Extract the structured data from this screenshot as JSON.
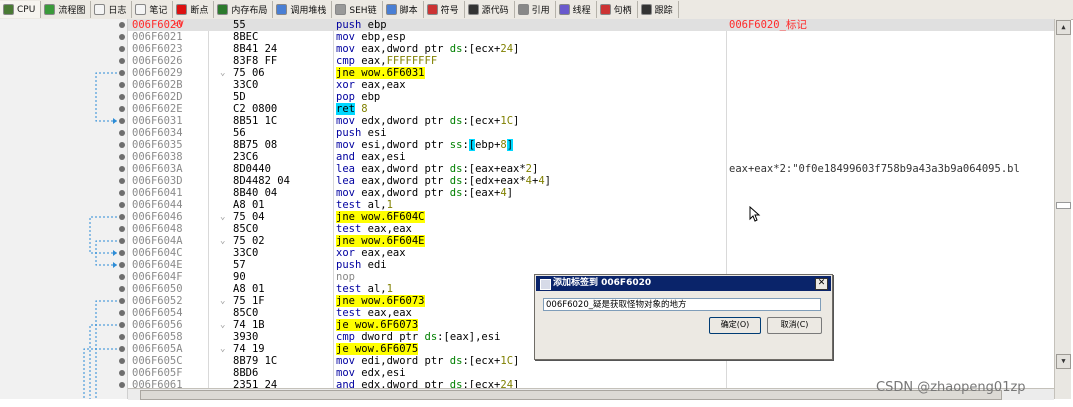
{
  "toolbar": {
    "tabs": [
      {
        "label": "CPU",
        "icon": "cpu-icon",
        "color": "#4a7a33"
      },
      {
        "label": "流程图",
        "icon": "flowchart-icon",
        "color": "#3a9a3a"
      },
      {
        "label": "日志",
        "icon": "log-icon",
        "color": "#f4f4f4"
      },
      {
        "label": "笔记",
        "icon": "notes-icon",
        "color": "#f4f4f4"
      },
      {
        "label": "断点",
        "icon": "breakpoint-icon",
        "color": "#d11"
      },
      {
        "label": "内存布局",
        "icon": "memory-map-icon",
        "color": "#2c7a2c"
      },
      {
        "label": "调用堆栈",
        "icon": "call-stack-icon",
        "color": "#4a7fd4"
      },
      {
        "label": "SEH链",
        "icon": "seh-chain-icon",
        "color": "#999"
      },
      {
        "label": "脚本",
        "icon": "script-icon",
        "color": "#4a7fd4"
      },
      {
        "label": "符号",
        "icon": "symbols-icon",
        "color": "#c33"
      },
      {
        "label": "源代码",
        "icon": "source-code-icon",
        "color": "#333"
      },
      {
        "label": "引用",
        "icon": "references-icon",
        "color": "#888"
      },
      {
        "label": "线程",
        "icon": "threads-icon",
        "color": "#6a5acd"
      },
      {
        "label": "句柄",
        "icon": "handles-icon",
        "color": "#c33"
      },
      {
        "label": "跟踪",
        "icon": "trace-icon",
        "color": "#333"
      }
    ]
  },
  "rows": [
    {
      "addr": "006F6020",
      "selmark": "<V",
      "jmark": "",
      "bytes": "55",
      "disasm": [
        [
          "kw",
          "push"
        ],
        [
          "t",
          " ebp"
        ]
      ],
      "comment": "006F6020_标记",
      "selected": true
    },
    {
      "addr": "006F6021",
      "bytes": "8BEC",
      "disasm": [
        [
          "kw",
          "mov"
        ],
        [
          "t",
          " ebp,esp"
        ]
      ]
    },
    {
      "addr": "006F6023",
      "bytes": "8B41 24",
      "disasm": [
        [
          "kw",
          "mov"
        ],
        [
          "t",
          " eax,dword ptr "
        ],
        [
          "sreg",
          "ds"
        ],
        [
          "t",
          ":[ecx+"
        ],
        [
          "num",
          "24"
        ],
        [
          "t",
          "]"
        ]
      ]
    },
    {
      "addr": "006F6026",
      "bytes": "83F8 FF",
      "disasm": [
        [
          "kw",
          "cmp"
        ],
        [
          "t",
          " eax,"
        ],
        [
          "num",
          "FFFFFFFF"
        ]
      ]
    },
    {
      "addr": "006F6029",
      "jmark": "⌄",
      "bytes": "75 06",
      "disasm": [
        [
          "hl",
          "jne wow.6F6031"
        ]
      ]
    },
    {
      "addr": "006F602B",
      "bytes": "33C0",
      "disasm": [
        [
          "kw",
          "xor"
        ],
        [
          "t",
          " eax,eax"
        ]
      ]
    },
    {
      "addr": "006F602D",
      "bytes": "5D",
      "disasm": [
        [
          "kw",
          "pop"
        ],
        [
          "t",
          " ebp"
        ]
      ]
    },
    {
      "addr": "006F602E",
      "bytes": "C2 0800",
      "disasm": [
        [
          "hlret",
          "ret"
        ],
        [
          "t",
          " "
        ],
        [
          "num",
          "8"
        ]
      ]
    },
    {
      "addr": "006F6031",
      "bytes": "8B51 1C",
      "disasm": [
        [
          "kw",
          "mov"
        ],
        [
          "t",
          " edx,dword ptr "
        ],
        [
          "sreg",
          "ds"
        ],
        [
          "t",
          ":[ecx+"
        ],
        [
          "num",
          "1C"
        ],
        [
          "t",
          "]"
        ]
      ]
    },
    {
      "addr": "006F6034",
      "bytes": "56",
      "disasm": [
        [
          "kw",
          "push"
        ],
        [
          "t",
          " esi"
        ]
      ]
    },
    {
      "addr": "006F6035",
      "bytes": "8B75 08",
      "disasm": [
        [
          "kw",
          "mov"
        ],
        [
          "t",
          " esi,dword ptr "
        ],
        [
          "sreg",
          "ss"
        ],
        [
          "t",
          ":"
        ],
        [
          "hlret",
          "["
        ],
        [
          "t",
          "ebp+"
        ],
        [
          "num",
          "8"
        ],
        [
          "hlret",
          "]"
        ]
      ]
    },
    {
      "addr": "006F6038",
      "bytes": "23C6",
      "disasm": [
        [
          "kw",
          "and"
        ],
        [
          "t",
          " eax,esi"
        ]
      ]
    },
    {
      "addr": "006F603A",
      "bytes": "8D0440",
      "disasm": [
        [
          "kw",
          "lea"
        ],
        [
          "t",
          " eax,dword ptr "
        ],
        [
          "sreg",
          "ds"
        ],
        [
          "t",
          ":[eax+eax*"
        ],
        [
          "num",
          "2"
        ],
        [
          "t",
          "]"
        ]
      ],
      "comment": "eax+eax*2:\"0f0e18499603f758b9a43a3b9a064095.bl"
    },
    {
      "addr": "006F603D",
      "bytes": "8D4482 04",
      "disasm": [
        [
          "kw",
          "lea"
        ],
        [
          "t",
          " eax,dword ptr "
        ],
        [
          "sreg",
          "ds"
        ],
        [
          "t",
          ":[edx+eax*"
        ],
        [
          "num",
          "4"
        ],
        [
          "t",
          "+"
        ],
        [
          "num",
          "4"
        ],
        [
          "t",
          "]"
        ]
      ]
    },
    {
      "addr": "006F6041",
      "bytes": "8B40 04",
      "disasm": [
        [
          "kw",
          "mov"
        ],
        [
          "t",
          " eax,dword ptr "
        ],
        [
          "sreg",
          "ds"
        ],
        [
          "t",
          ":[eax+"
        ],
        [
          "num",
          "4"
        ],
        [
          "t",
          "]"
        ]
      ]
    },
    {
      "addr": "006F6044",
      "bytes": "A8 01",
      "disasm": [
        [
          "kw",
          "test"
        ],
        [
          "t",
          " al,"
        ],
        [
          "num",
          "1"
        ]
      ]
    },
    {
      "addr": "006F6046",
      "jmark": "⌄",
      "bytes": "75 04",
      "disasm": [
        [
          "hl",
          "jne wow.6F604C"
        ]
      ]
    },
    {
      "addr": "006F6048",
      "bytes": "85C0",
      "disasm": [
        [
          "kw",
          "test"
        ],
        [
          "t",
          " eax,eax"
        ]
      ]
    },
    {
      "addr": "006F604A",
      "jmark": "⌄",
      "bytes": "75 02",
      "disasm": [
        [
          "hl",
          "jne wow.6F604E"
        ]
      ]
    },
    {
      "addr": "006F604C",
      "bytes": "33C0",
      "disasm": [
        [
          "kw",
          "xor"
        ],
        [
          "t",
          " eax,eax"
        ]
      ]
    },
    {
      "addr": "006F604E",
      "bytes": "57",
      "disasm": [
        [
          "kw",
          "push"
        ],
        [
          "t",
          " edi"
        ]
      ]
    },
    {
      "addr": "006F604F",
      "bytes": "90",
      "disasm": [
        [
          "nop",
          "nop"
        ]
      ]
    },
    {
      "addr": "006F6050",
      "bytes": "A8 01",
      "disasm": [
        [
          "kw",
          "test"
        ],
        [
          "t",
          " al,"
        ],
        [
          "num",
          "1"
        ]
      ]
    },
    {
      "addr": "006F6052",
      "jmark": "⌄",
      "bytes": "75 1F",
      "disasm": [
        [
          "hl",
          "jne wow.6F6073"
        ]
      ]
    },
    {
      "addr": "006F6054",
      "bytes": "85C0",
      "disasm": [
        [
          "kw",
          "test"
        ],
        [
          "t",
          " eax,eax"
        ]
      ]
    },
    {
      "addr": "006F6056",
      "jmark": "⌄",
      "bytes": "74 1B",
      "disasm": [
        [
          "hl",
          "je wow.6F6073"
        ]
      ]
    },
    {
      "addr": "006F6058",
      "bytes": "3930",
      "disasm": [
        [
          "kw",
          "cmp"
        ],
        [
          "t",
          " dword ptr "
        ],
        [
          "sreg",
          "ds"
        ],
        [
          "t",
          ":[eax],esi"
        ]
      ]
    },
    {
      "addr": "006F605A",
      "jmark": "⌄",
      "bytes": "74 19",
      "disasm": [
        [
          "hl",
          "je wow.6F6075"
        ]
      ]
    },
    {
      "addr": "006F605C",
      "bytes": "8B79 1C",
      "disasm": [
        [
          "kw",
          "mov"
        ],
        [
          "t",
          " edi,dword ptr "
        ],
        [
          "sreg",
          "ds"
        ],
        [
          "t",
          ":[ecx+"
        ],
        [
          "num",
          "1C"
        ],
        [
          "t",
          "]"
        ]
      ]
    },
    {
      "addr": "006F605F",
      "bytes": "8BD6",
      "disasm": [
        [
          "kw",
          "mov"
        ],
        [
          "t",
          " edx,esi"
        ]
      ]
    },
    {
      "addr": "006F6061",
      "bytes": "2351 24",
      "disasm": [
        [
          "kw",
          "and"
        ],
        [
          "t",
          " edx,dword ptr "
        ],
        [
          "sreg",
          "ds"
        ],
        [
          "t",
          ":[ecx+"
        ],
        [
          "num",
          "24"
        ],
        [
          "t",
          "]"
        ]
      ]
    }
  ],
  "dialog": {
    "title": "添加标签到 006F6020",
    "input_value": "006F6020_疑是获取怪物对象的地方",
    "ok_label": "确定(O)",
    "cancel_label": "取消(C)",
    "close_label": "✕"
  },
  "watermark": "CSDN @zhaopeng01zp",
  "colors": {
    "jump_highlight": "#ffff00",
    "ret_highlight": "#00d8ff",
    "selected_address": "#ff2a2a",
    "dialog_title_bg": "#0a246a"
  }
}
